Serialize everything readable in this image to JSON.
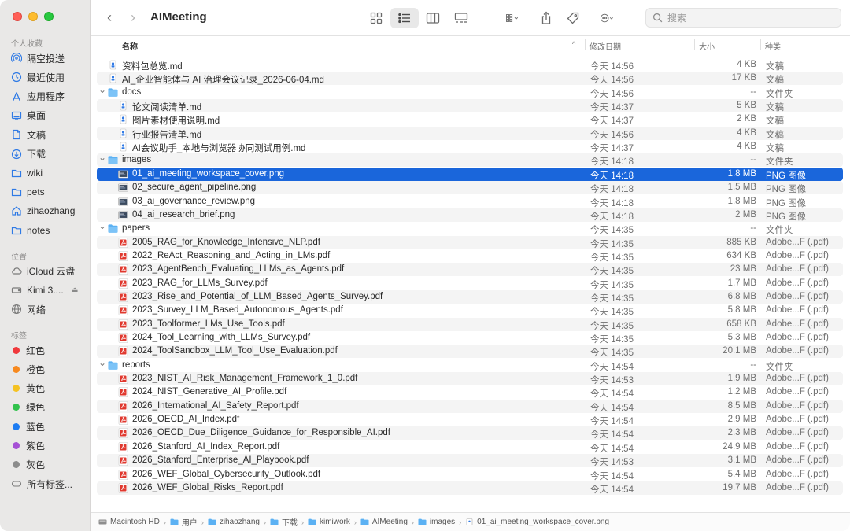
{
  "window": {
    "title": "AIMeeting"
  },
  "search": {
    "placeholder": "搜索"
  },
  "sidebar": {
    "favorites_label": "个人收藏",
    "favorites": [
      {
        "label": "隔空投送",
        "icon": "airdrop-icon"
      },
      {
        "label": "最近使用",
        "icon": "clock-icon"
      },
      {
        "label": "应用程序",
        "icon": "applications-icon"
      },
      {
        "label": "桌面",
        "icon": "desktop-icon"
      },
      {
        "label": "文稿",
        "icon": "document-icon"
      },
      {
        "label": "下载",
        "icon": "download-icon"
      },
      {
        "label": "wiki",
        "icon": "folder-icon"
      },
      {
        "label": "pets",
        "icon": "folder-icon"
      },
      {
        "label": "zihaozhang",
        "icon": "home-icon"
      },
      {
        "label": "notes",
        "icon": "folder-icon"
      }
    ],
    "locations_label": "位置",
    "locations": [
      {
        "label": "iCloud 云盘",
        "icon": "cloud-icon"
      },
      {
        "label": "Kimi 3....",
        "icon": "disk-icon"
      },
      {
        "label": "网络",
        "icon": "network-icon"
      }
    ],
    "tags_label": "标签",
    "tags": [
      {
        "label": "红色",
        "color": "#f0393c"
      },
      {
        "label": "橙色",
        "color": "#f7891f"
      },
      {
        "label": "黄色",
        "color": "#f5c223"
      },
      {
        "label": "绿色",
        "color": "#32c24d"
      },
      {
        "label": "蓝色",
        "color": "#1d7cf2"
      },
      {
        "label": "紫色",
        "color": "#a550d5"
      },
      {
        "label": "灰色",
        "color": "#8c8c8c"
      }
    ],
    "all_tags": "所有标签..."
  },
  "columns": {
    "name": "名称",
    "modified": "修改日期",
    "size": "大小",
    "kind": "种类"
  },
  "files": [
    {
      "name": "资料包总览.md",
      "date": "今天 14:56",
      "size": "4 KB",
      "kind": "文稿",
      "type": "md",
      "depth": 0
    },
    {
      "name": "AI_企业智能体与 AI 治理会议记录_2026-06-04.md",
      "date": "今天 14:56",
      "size": "17 KB",
      "kind": "文稿",
      "type": "md",
      "depth": 0
    },
    {
      "name": "docs",
      "date": "今天 14:56",
      "size": "--",
      "kind": "文件夹",
      "type": "folder",
      "depth": 0
    },
    {
      "name": "论文阅读清单.md",
      "date": "今天 14:37",
      "size": "5 KB",
      "kind": "文稿",
      "type": "md",
      "depth": 1
    },
    {
      "name": "图片素材使用说明.md",
      "date": "今天 14:37",
      "size": "2 KB",
      "kind": "文稿",
      "type": "md",
      "depth": 1
    },
    {
      "name": "行业报告清单.md",
      "date": "今天 14:56",
      "size": "4 KB",
      "kind": "文稿",
      "type": "md",
      "depth": 1
    },
    {
      "name": "AI会议助手_本地与浏览器协同测试用例.md",
      "date": "今天 14:37",
      "size": "4 KB",
      "kind": "文稿",
      "type": "md",
      "depth": 1
    },
    {
      "name": "images",
      "date": "今天 14:18",
      "size": "--",
      "kind": "文件夹",
      "type": "folder",
      "depth": 0
    },
    {
      "name": "01_ai_meeting_workspace_cover.png",
      "date": "今天 14:18",
      "size": "1.8 MB",
      "kind": "PNG 图像",
      "type": "png",
      "depth": 1,
      "selected": true
    },
    {
      "name": "02_secure_agent_pipeline.png",
      "date": "今天 14:18",
      "size": "1.5 MB",
      "kind": "PNG 图像",
      "type": "png",
      "depth": 1
    },
    {
      "name": "03_ai_governance_review.png",
      "date": "今天 14:18",
      "size": "1.8 MB",
      "kind": "PNG 图像",
      "type": "png",
      "depth": 1
    },
    {
      "name": "04_ai_research_brief.png",
      "date": "今天 14:18",
      "size": "2 MB",
      "kind": "PNG 图像",
      "type": "png",
      "depth": 1
    },
    {
      "name": "papers",
      "date": "今天 14:35",
      "size": "--",
      "kind": "文件夹",
      "type": "folder",
      "depth": 0
    },
    {
      "name": "2005_RAG_for_Knowledge_Intensive_NLP.pdf",
      "date": "今天 14:35",
      "size": "885 KB",
      "kind": "Adobe...F (.pdf)",
      "type": "pdf",
      "depth": 1
    },
    {
      "name": "2022_ReAct_Reasoning_and_Acting_in_LMs.pdf",
      "date": "今天 14:35",
      "size": "634 KB",
      "kind": "Adobe...F (.pdf)",
      "type": "pdf",
      "depth": 1
    },
    {
      "name": "2023_AgentBench_Evaluating_LLMs_as_Agents.pdf",
      "date": "今天 14:35",
      "size": "23 MB",
      "kind": "Adobe...F (.pdf)",
      "type": "pdf",
      "depth": 1
    },
    {
      "name": "2023_RAG_for_LLMs_Survey.pdf",
      "date": "今天 14:35",
      "size": "1.7 MB",
      "kind": "Adobe...F (.pdf)",
      "type": "pdf",
      "depth": 1
    },
    {
      "name": "2023_Rise_and_Potential_of_LLM_Based_Agents_Survey.pdf",
      "date": "今天 14:35",
      "size": "6.8 MB",
      "kind": "Adobe...F (.pdf)",
      "type": "pdf",
      "depth": 1
    },
    {
      "name": "2023_Survey_LLM_Based_Autonomous_Agents.pdf",
      "date": "今天 14:35",
      "size": "5.8 MB",
      "kind": "Adobe...F (.pdf)",
      "type": "pdf",
      "depth": 1
    },
    {
      "name": "2023_Toolformer_LMs_Use_Tools.pdf",
      "date": "今天 14:35",
      "size": "658 KB",
      "kind": "Adobe...F (.pdf)",
      "type": "pdf",
      "depth": 1
    },
    {
      "name": "2024_Tool_Learning_with_LLMs_Survey.pdf",
      "date": "今天 14:35",
      "size": "5.3 MB",
      "kind": "Adobe...F (.pdf)",
      "type": "pdf",
      "depth": 1
    },
    {
      "name": "2024_ToolSandbox_LLM_Tool_Use_Evaluation.pdf",
      "date": "今天 14:35",
      "size": "20.1 MB",
      "kind": "Adobe...F (.pdf)",
      "type": "pdf",
      "depth": 1
    },
    {
      "name": "reports",
      "date": "今天 14:54",
      "size": "--",
      "kind": "文件夹",
      "type": "folder",
      "depth": 0
    },
    {
      "name": "2023_NIST_AI_Risk_Management_Framework_1_0.pdf",
      "date": "今天 14:53",
      "size": "1.9 MB",
      "kind": "Adobe...F (.pdf)",
      "type": "pdf",
      "depth": 1
    },
    {
      "name": "2024_NIST_Generative_AI_Profile.pdf",
      "date": "今天 14:54",
      "size": "1.2 MB",
      "kind": "Adobe...F (.pdf)",
      "type": "pdf",
      "depth": 1
    },
    {
      "name": "2026_International_AI_Safety_Report.pdf",
      "date": "今天 14:54",
      "size": "8.5 MB",
      "kind": "Adobe...F (.pdf)",
      "type": "pdf",
      "depth": 1
    },
    {
      "name": "2026_OECD_AI_Index.pdf",
      "date": "今天 14:54",
      "size": "2.9 MB",
      "kind": "Adobe...F (.pdf)",
      "type": "pdf",
      "depth": 1
    },
    {
      "name": "2026_OECD_Due_Diligence_Guidance_for_Responsible_AI.pdf",
      "date": "今天 14:54",
      "size": "2.3 MB",
      "kind": "Adobe...F (.pdf)",
      "type": "pdf",
      "depth": 1
    },
    {
      "name": "2026_Stanford_AI_Index_Report.pdf",
      "date": "今天 14:54",
      "size": "24.9 MB",
      "kind": "Adobe...F (.pdf)",
      "type": "pdf",
      "depth": 1
    },
    {
      "name": "2026_Stanford_Enterprise_AI_Playbook.pdf",
      "date": "今天 14:53",
      "size": "3.1 MB",
      "kind": "Adobe...F (.pdf)",
      "type": "pdf",
      "depth": 1
    },
    {
      "name": "2026_WEF_Global_Cybersecurity_Outlook.pdf",
      "date": "今天 14:54",
      "size": "5.4 MB",
      "kind": "Adobe...F (.pdf)",
      "type": "pdf",
      "depth": 1
    },
    {
      "name": "2026_WEF_Global_Risks_Report.pdf",
      "date": "今天 14:54",
      "size": "19.7 MB",
      "kind": "Adobe...F (.pdf)",
      "type": "pdf",
      "depth": 1
    }
  ],
  "pathbar": [
    {
      "label": "Macintosh HD",
      "icon": "disk-icon"
    },
    {
      "label": "用户",
      "icon": "folder-icon"
    },
    {
      "label": "zihaozhang",
      "icon": "folder-icon"
    },
    {
      "label": "下载",
      "icon": "folder-icon"
    },
    {
      "label": "kimiwork",
      "icon": "folder-icon"
    },
    {
      "label": "AIMeeting",
      "icon": "folder-icon"
    },
    {
      "label": "images",
      "icon": "folder-icon"
    },
    {
      "label": "01_ai_meeting_workspace_cover.png",
      "icon": "image-file-icon"
    }
  ],
  "colors": {
    "accent": "#1a66db",
    "folder": "#4aa8f0",
    "pdf": "#e0392f"
  }
}
